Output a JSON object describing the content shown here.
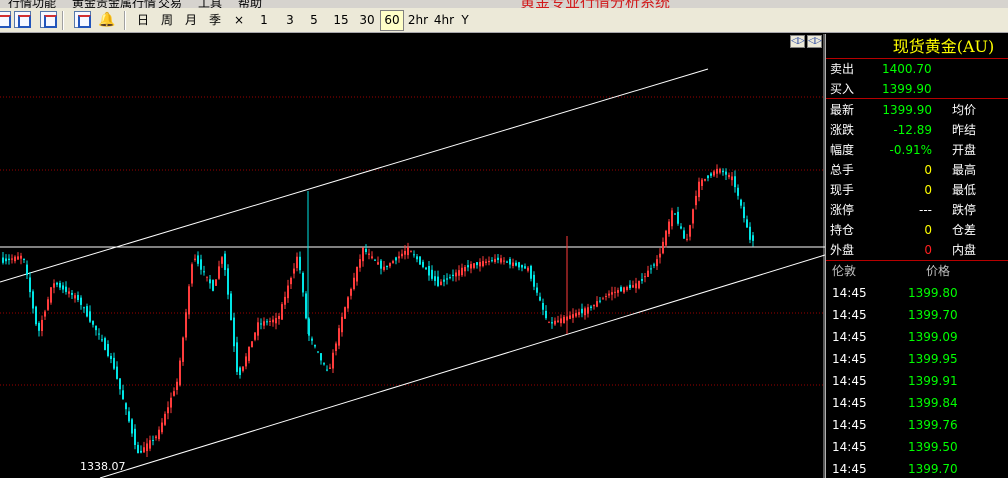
{
  "menu": {
    "items": [
      "行情功能",
      "黄金贵金属行情",
      "交易",
      "工具",
      "帮助"
    ],
    "app_title": "黄金专业行情分析系统"
  },
  "toolbar": {
    "periods": [
      {
        "label": "日",
        "active": false
      },
      {
        "label": "周",
        "active": false
      },
      {
        "label": "月",
        "active": false
      },
      {
        "label": "季",
        "active": false
      },
      {
        "label": "×",
        "active": false
      },
      {
        "label": "1",
        "active": false
      },
      {
        "label": "3",
        "active": false
      },
      {
        "label": "5",
        "active": false
      },
      {
        "label": "15",
        "active": false
      },
      {
        "label": "30",
        "active": false
      },
      {
        "label": "60",
        "active": true
      },
      {
        "label": "2hr",
        "active": false
      },
      {
        "label": "4hr",
        "active": false
      },
      {
        "label": "Y",
        "active": false
      }
    ]
  },
  "chart": {
    "low_label": "1338.07",
    "colors": {
      "up": "#ff3c3c",
      "down": "#00e5e5",
      "grid": "#9a0000",
      "line": "#ffffff"
    }
  },
  "quote": {
    "symbol": "现货黄金(AU)",
    "sell_label": "卖出",
    "sell": "1400.70",
    "buy_label": "买入",
    "buy": "1399.90",
    "latest_label": "最新",
    "latest": "1399.90",
    "avg_label": "均价",
    "change_label": "涨跌",
    "change": "-12.89",
    "prev_close_label": "昨结",
    "pct_label": "幅度",
    "pct": "-0.91%",
    "open_label": "开盘",
    "volume_label": "总手",
    "volume": "0",
    "high_label": "最高",
    "curvol_label": "现手",
    "curvol": "0",
    "low_label": "最低",
    "limitup_label": "涨停",
    "limitup": "---",
    "limitdown_label": "跌停",
    "oi_label": "持仓",
    "oi": "0",
    "oi_diff_label": "仓差",
    "outer_label": "外盘",
    "outer": "0",
    "inner_label": "内盘"
  },
  "ticks": {
    "time_header": "伦敦",
    "price_header": "价格",
    "rows": [
      {
        "time": "14:45",
        "price": "1399.80"
      },
      {
        "time": "14:45",
        "price": "1399.70"
      },
      {
        "time": "14:45",
        "price": "1399.09"
      },
      {
        "time": "14:45",
        "price": "1399.95"
      },
      {
        "time": "14:45",
        "price": "1399.91"
      },
      {
        "time": "14:45",
        "price": "1399.84"
      },
      {
        "time": "14:45",
        "price": "1399.76"
      },
      {
        "time": "14:45",
        "price": "1399.50"
      },
      {
        "time": "14:45",
        "price": "1399.70"
      }
    ]
  }
}
